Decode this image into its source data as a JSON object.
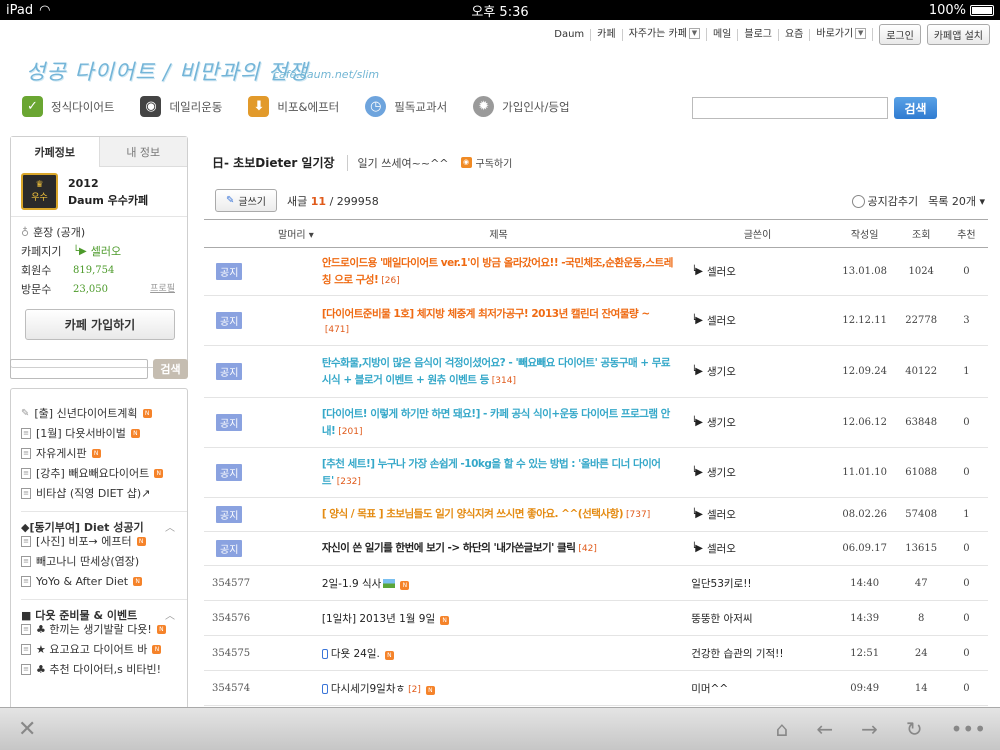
{
  "status": {
    "device": "iPad",
    "time": "오후 5:36",
    "battery": "100%"
  },
  "topnav": {
    "links": [
      "Daum",
      "카페",
      "자주가는 카페",
      "메일",
      "블로그",
      "요즘",
      "바로가기"
    ],
    "login": "로그인",
    "app_install": "카페앱 설치"
  },
  "logo": {
    "text": "성공 다이어트 / 비만과의 전쟁",
    "url": "cafe.daum.net/slim"
  },
  "menu": [
    {
      "label": "정식다이어트",
      "icon": "check-icon",
      "color": "#6aa632"
    },
    {
      "label": "데일리운동",
      "icon": "speaker-icon",
      "color": "#444444"
    },
    {
      "label": "비포&에프터",
      "icon": "download-arrow-icon",
      "color": "#e29a2b"
    },
    {
      "label": "필독교과서",
      "icon": "clock-icon",
      "color": "#6ea4dd"
    },
    {
      "label": "가입인사/등업",
      "icon": "gear-icon",
      "color": "#9a9a9a"
    }
  ],
  "search": {
    "button": "검색"
  },
  "cafe": {
    "tabs": [
      "카페정보",
      "내 정보"
    ],
    "rank_year": "2012",
    "rank_text": "Daum 우수카페",
    "badge_text": "우수",
    "manager_label": "훈장",
    "manager_value": "(공개)",
    "keeper_label": "카페지기",
    "keeper_name": "셀러오",
    "members_label": "회원수",
    "members": "819,754",
    "visits_label": "방문수",
    "visits": "23,050",
    "profile": "프로필",
    "join": "카페 가입하기"
  },
  "sidesearch": {
    "button": "검색"
  },
  "sidemenu": {
    "items1": [
      "[출] 신년다이어트계획",
      "[1월] 다욧서바이벌",
      "자유게시판",
      "[강추] 빼요빼요다이어트",
      "비타샵 (직영 DIET 샵)↗"
    ],
    "group2": "◆[동기부여] Diet 성공기",
    "items2": [
      "[사진] 비포→ 에프터",
      "빼고나니 딴세상(염장)",
      "YoYo & After Diet"
    ],
    "group3": "■ 다욧 준비물 & 이벤트",
    "items3": [
      "♣ 한끼는 생기발랄 다욧!",
      "★ 요고요고 다이어트 바",
      "♣ 추천 다이어터,s 비타빈!"
    ]
  },
  "board": {
    "title": "日- 초보Dieter 일기장",
    "desc": "일기 쓰세여~~^^",
    "subscribe": "구독하기",
    "write": "글쓰기",
    "count_label": "새글",
    "new_count": "11",
    "total": "/ 299958",
    "hide_notice": "공지감추기",
    "list_opt": "목록 20개 ▾",
    "headers": {
      "num": "말머리 ▾",
      "subject": "제목",
      "author": "글쓴이",
      "date": "작성일",
      "views": "조회",
      "rec": "추천"
    },
    "notice_label": "공지",
    "rows": [
      {
        "notice": true,
        "style": "orange",
        "subject": "안드로이드용 '매일다이어트 ver.1'이 방금 올라갔어요!! -국민체조,순환운동,스트레칭 으로 구성!",
        "cmt": "[26]",
        "author": "셀러오",
        "date": "13.01.08",
        "views": "1024",
        "rec": "0"
      },
      {
        "notice": true,
        "style": "orange",
        "subject": "[다이어트준비물 1호] 체지방 체중계 최저가공구! 2013년 캘린더 잔여물량 ~",
        "cmt": "[471]",
        "author": "셀러오",
        "date": "12.12.11",
        "views": "22778",
        "rec": "3"
      },
      {
        "notice": true,
        "style": "teal",
        "subject": "탄수화물,지방이 많은 음식이 걱정이셨어요? - '빼요빼요 다이어트' 공동구매 + 무료시식 + 블로거 이벤트 + 원츄 이벤트 등",
        "cmt": "[314]",
        "author": "생기오",
        "date": "12.09.24",
        "views": "40122",
        "rec": "1"
      },
      {
        "notice": true,
        "style": "teal",
        "subject": "[다이어트! 이렇게 하기만 하면 돼요!] - 카페 공식 식이+운동 다이어트 프로그램 안내!",
        "cmt": "[201]",
        "author": "생기오",
        "date": "12.06.12",
        "views": "63848",
        "rec": "0"
      },
      {
        "notice": true,
        "style": "teal",
        "subject": "[추천 세트!] 누구나 가장 손쉽게 -10kg을 할 수 있는 방법 : '올바른 디너 다이어트'",
        "cmt": "[232]",
        "author": "생기오",
        "date": "11.01.10",
        "views": "61088",
        "rec": "0"
      },
      {
        "notice": true,
        "style": "gold",
        "subject": "[ 양식 / 목표 ] 초보님들도 일기 양식지켜 쓰시면 좋아요. ^^(선택사항)",
        "cmt": "[737]",
        "author": "셀러오",
        "date": "08.02.26",
        "views": "57408",
        "rec": "1"
      },
      {
        "notice": true,
        "style": "dark",
        "subject": "자신이 쓴 일기를 한번에 보기 -> 하단의 '내가쓴글보기' 클릭",
        "cmt": "[42]",
        "author": "셀러오",
        "date": "06.09.17",
        "views": "13615",
        "rec": "0"
      },
      {
        "notice": false,
        "num": "354577",
        "style": "plain",
        "subject": "2일-1.9 식사",
        "cmt": "",
        "author": "일단53키로!!",
        "date": "14:40",
        "views": "47",
        "rec": "0",
        "pic": true
      },
      {
        "notice": false,
        "num": "354576",
        "style": "plain",
        "subject": "[1일차] 2013년 1월 9일",
        "cmt": "",
        "author": "뚱뚱한 아저씨",
        "date": "14:39",
        "views": "8",
        "rec": "0"
      },
      {
        "notice": false,
        "num": "354575",
        "style": "plain",
        "subject": "다욧 24일.",
        "cmt": "",
        "author": "건강한 습관의 기적!!",
        "date": "12:51",
        "views": "24",
        "rec": "0",
        "phone": true
      },
      {
        "notice": false,
        "num": "354574",
        "style": "plain",
        "subject": "다시세기9일차ㅎ",
        "cmt": "[2]",
        "author": "미머^^",
        "date": "09:49",
        "views": "14",
        "rec": "0",
        "phone": true
      }
    ]
  }
}
